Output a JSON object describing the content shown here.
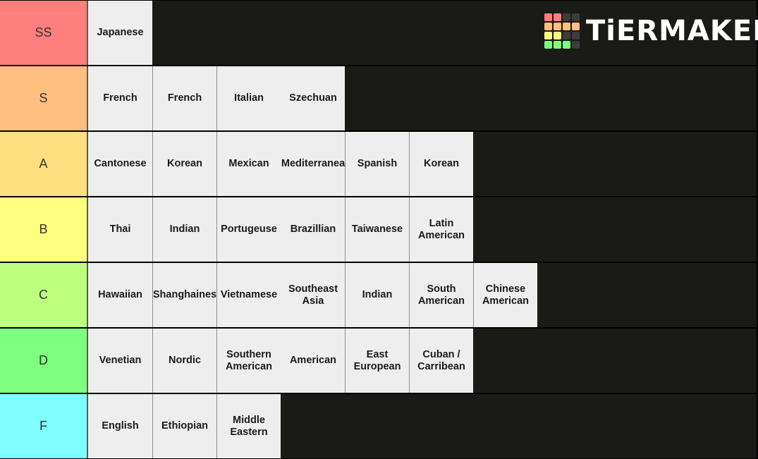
{
  "logo": {
    "text": "TiERMAKER",
    "grid": [
      [
        "#ff7f7f",
        "#ff7f7f",
        "#3c3c3c",
        "#3c3c3c"
      ],
      [
        "#ffbf7f",
        "#ffbf7f",
        "#ffbf7f",
        "#ffbf7f"
      ],
      [
        "#ffff7f",
        "#ffff7f",
        "#3c3c3c",
        "#3c3c3c"
      ],
      [
        "#7fff7f",
        "#7fff7f",
        "#7fff7f",
        "#3c3c3c"
      ]
    ]
  },
  "tiers": [
    {
      "label": "SS",
      "color": "#ff7f7f",
      "items": [
        "Japanese"
      ]
    },
    {
      "label": "S",
      "color": "#ffbf7f",
      "items": [
        "French",
        "French",
        "Italian",
        "Szechuan"
      ]
    },
    {
      "label": "A",
      "color": "#ffdf7f",
      "items": [
        "Cantonese",
        "Korean",
        "Mexican",
        "Mediterranea",
        "Spanish",
        "Korean"
      ]
    },
    {
      "label": "B",
      "color": "#ffff7f",
      "items": [
        "Thai",
        "Indian",
        "Portugeuse",
        "Brazillian",
        "Taiwanese",
        "Latin\nAmerican"
      ]
    },
    {
      "label": "C",
      "color": "#bfff7f",
      "items": [
        "Hawaiian",
        "Shanghaines",
        "Vietnamese",
        "Southeast\nAsia",
        "Indian",
        "South\nAmerican",
        "Chinese\nAmerican"
      ]
    },
    {
      "label": "D",
      "color": "#7fff7f",
      "items": [
        "Venetian",
        "Nordic",
        "Southern\nAmerican",
        "American",
        "East\nEuropean",
        "Cuban /\nCarribean"
      ]
    },
    {
      "label": "F",
      "color": "#7fffff",
      "items": [
        "English",
        "Ethiopian",
        "Middle\nEastern"
      ]
    }
  ]
}
